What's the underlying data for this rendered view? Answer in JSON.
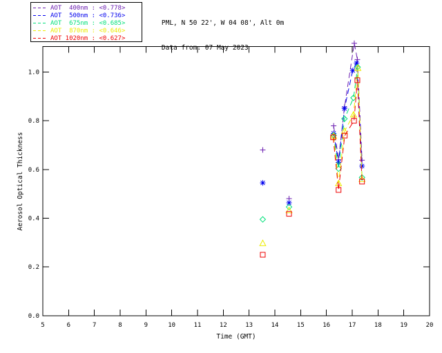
{
  "header": {
    "title_line1": "PML, N 50 22', W 04 08', Alt 0m",
    "title_line2": "Data from: 07 May 2023"
  },
  "legend": {
    "position": "top-left",
    "entries": [
      {
        "label": "AOT  400nm : <0.778>",
        "color": "#6A1CB0"
      },
      {
        "label": "AOT  500nm : <0.736>",
        "color": "#0000EE"
      },
      {
        "label": "AOT  675nm : <0.685>",
        "color": "#00E07A"
      },
      {
        "label": "AOT  870nm : <0.646>",
        "color": "#ECEC00"
      },
      {
        "label": "AOT 1020nm : <0.627>",
        "color": "#EE0000"
      }
    ]
  },
  "chart_data": {
    "type": "line",
    "title": "PML, N 50 22', W 04 08', Alt 0m — Data from: 07 May 2023",
    "xlabel": "Time (GMT)",
    "ylabel": "Aerosol Optical Thickness",
    "xlim": [
      5,
      20
    ],
    "ylim": [
      0.0,
      1.105
    ],
    "grid": false,
    "xtick_labels": [
      "5",
      "6",
      "7",
      "8",
      "9",
      "10",
      "11",
      "12",
      "13",
      "14",
      "15",
      "16",
      "17",
      "18",
      "19",
      "20"
    ],
    "xtick_values": [
      5,
      6,
      7,
      8,
      9,
      10,
      11,
      12,
      13,
      14,
      15,
      16,
      17,
      18,
      19,
      20
    ],
    "ytick_labels": [
      "0.0",
      "0.2",
      "0.4",
      "0.6",
      "0.8",
      "1.0"
    ],
    "ytick_values": [
      0.0,
      0.2,
      0.4,
      0.6,
      0.8,
      1.0
    ],
    "line_style": "dashed",
    "series": [
      {
        "name": "AOT 400nm",
        "mean_label": "<0.778>",
        "color": "#6A1CB0",
        "marker": "plus",
        "isolated_points": [
          {
            "t": 13.53,
            "v": 0.68
          },
          {
            "t": 14.55,
            "v": 0.48
          }
        ],
        "line_points": [
          {
            "t": 16.28,
            "v": 0.779
          },
          {
            "t": 16.47,
            "v": 0.64
          },
          {
            "t": 16.7,
            "v": 0.856
          },
          {
            "t": 17.08,
            "v": 1.118
          },
          {
            "t": 17.2,
            "v": 1.051
          },
          {
            "t": 17.38,
            "v": 0.638
          }
        ]
      },
      {
        "name": "AOT 500nm",
        "mean_label": "<0.736>",
        "color": "#0000EE",
        "marker": "asterisk",
        "isolated_points": [
          {
            "t": 13.53,
            "v": 0.545
          },
          {
            "t": 14.55,
            "v": 0.463
          }
        ],
        "line_points": [
          {
            "t": 16.28,
            "v": 0.748
          },
          {
            "t": 16.47,
            "v": 0.629
          },
          {
            "t": 16.7,
            "v": 0.85
          },
          {
            "t": 17.02,
            "v": 1.006
          },
          {
            "t": 17.17,
            "v": 1.037
          },
          {
            "t": 17.38,
            "v": 0.614
          }
        ]
      },
      {
        "name": "AOT 675nm",
        "mean_label": "<0.685>",
        "color": "#00E07A",
        "marker": "diamond",
        "isolated_points": [
          {
            "t": 13.53,
            "v": 0.395
          },
          {
            "t": 14.55,
            "v": 0.446
          }
        ],
        "line_points": [
          {
            "t": 16.28,
            "v": 0.74
          },
          {
            "t": 16.47,
            "v": 0.603
          },
          {
            "t": 16.7,
            "v": 0.808
          },
          {
            "t": 17.05,
            "v": 0.894
          },
          {
            "t": 17.21,
            "v": 1.02
          },
          {
            "t": 17.38,
            "v": 0.567
          }
        ]
      },
      {
        "name": "AOT 870nm",
        "mean_label": "<0.646>",
        "color": "#ECEC00",
        "marker": "triangle",
        "isolated_points": [
          {
            "t": 13.53,
            "v": 0.297
          },
          {
            "t": 14.55,
            "v": 0.432
          }
        ],
        "line_points": [
          {
            "t": 16.28,
            "v": 0.737
          },
          {
            "t": 16.47,
            "v": 0.543
          },
          {
            "t": 16.7,
            "v": 0.757
          },
          {
            "t": 17.05,
            "v": 0.825
          },
          {
            "t": 17.22,
            "v": 1.016
          },
          {
            "t": 17.38,
            "v": 0.56
          }
        ]
      },
      {
        "name": "AOT 1020nm",
        "mean_label": "<0.627>",
        "color": "#EE0000",
        "marker": "square",
        "isolated_points": [
          {
            "t": 13.53,
            "v": 0.25
          },
          {
            "t": 14.55,
            "v": 0.418
          }
        ],
        "line_points": [
          {
            "t": 16.26,
            "v": 0.732
          },
          {
            "t": 16.47,
            "v": 0.516
          },
          {
            "t": 16.71,
            "v": 0.739
          },
          {
            "t": 17.07,
            "v": 0.8
          },
          {
            "t": 17.2,
            "v": 0.966
          },
          {
            "t": 17.38,
            "v": 0.55
          }
        ]
      }
    ]
  }
}
